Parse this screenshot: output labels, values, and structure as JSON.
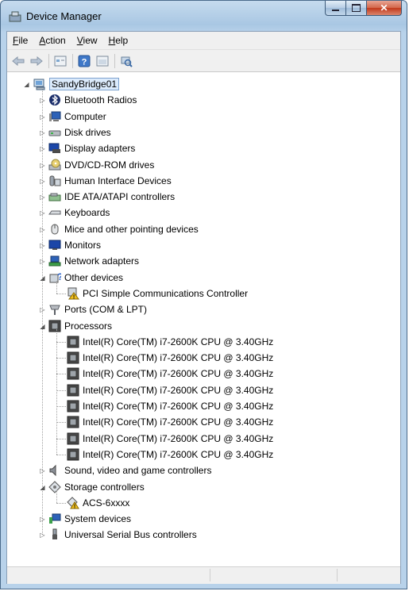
{
  "window": {
    "title": "Device Manager"
  },
  "menu": [
    {
      "label": "File",
      "accel": "F",
      "rest": "ile"
    },
    {
      "label": "Action",
      "accel": "A",
      "rest": "ction"
    },
    {
      "label": "View",
      "accel": "V",
      "rest": "iew"
    },
    {
      "label": "Help",
      "accel": "H",
      "rest": "elp"
    }
  ],
  "toolbar": {
    "icons": [
      "back-arrow-icon",
      "forward-arrow-icon",
      "properties-icon",
      "help-icon",
      "view-icon",
      "scan-hardware-icon"
    ]
  },
  "tree": {
    "root": "SandyBridge01",
    "categories": [
      {
        "label": "Bluetooth Radios",
        "icon": "bluetooth-icon",
        "expanded": false
      },
      {
        "label": "Computer",
        "icon": "computer-icon",
        "expanded": false
      },
      {
        "label": "Disk drives",
        "icon": "disk-icon",
        "expanded": false
      },
      {
        "label": "Display adapters",
        "icon": "display-icon",
        "expanded": false
      },
      {
        "label": "DVD/CD-ROM drives",
        "icon": "dvd-icon",
        "expanded": false
      },
      {
        "label": "Human Interface Devices",
        "icon": "hid-icon",
        "expanded": false
      },
      {
        "label": "IDE ATA/ATAPI controllers",
        "icon": "ide-icon",
        "expanded": false
      },
      {
        "label": "Keyboards",
        "icon": "keyboard-icon",
        "expanded": false
      },
      {
        "label": "Mice and other pointing devices",
        "icon": "mouse-icon",
        "expanded": false
      },
      {
        "label": "Monitors",
        "icon": "monitor-icon",
        "expanded": false
      },
      {
        "label": "Network adapters",
        "icon": "network-icon",
        "expanded": false
      },
      {
        "label": "Other devices",
        "icon": "other-devices-icon",
        "expanded": true,
        "children": [
          {
            "label": "PCI Simple Communications Controller",
            "icon": "warning-device-icon"
          }
        ]
      },
      {
        "label": "Ports (COM & LPT)",
        "icon": "port-icon",
        "expanded": false
      },
      {
        "label": "Processors",
        "icon": "processor-icon",
        "expanded": true,
        "children": [
          {
            "label": "Intel(R) Core(TM) i7-2600K CPU @ 3.40GHz",
            "icon": "processor-icon"
          },
          {
            "label": "Intel(R) Core(TM) i7-2600K CPU @ 3.40GHz",
            "icon": "processor-icon"
          },
          {
            "label": "Intel(R) Core(TM) i7-2600K CPU @ 3.40GHz",
            "icon": "processor-icon"
          },
          {
            "label": "Intel(R) Core(TM) i7-2600K CPU @ 3.40GHz",
            "icon": "processor-icon"
          },
          {
            "label": "Intel(R) Core(TM) i7-2600K CPU @ 3.40GHz",
            "icon": "processor-icon"
          },
          {
            "label": "Intel(R) Core(TM) i7-2600K CPU @ 3.40GHz",
            "icon": "processor-icon"
          },
          {
            "label": "Intel(R) Core(TM) i7-2600K CPU @ 3.40GHz",
            "icon": "processor-icon"
          },
          {
            "label": "Intel(R) Core(TM) i7-2600K CPU @ 3.40GHz",
            "icon": "processor-icon"
          }
        ]
      },
      {
        "label": "Sound, video and game controllers",
        "icon": "speaker-icon",
        "expanded": false
      },
      {
        "label": "Storage controllers",
        "icon": "storage-icon",
        "expanded": true,
        "children": [
          {
            "label": "ACS-6xxxx",
            "icon": "warning-storage-icon"
          }
        ]
      },
      {
        "label": "System devices",
        "icon": "system-icon",
        "expanded": false
      },
      {
        "label": "Universal Serial Bus controllers",
        "icon": "usb-icon",
        "expanded": false
      }
    ]
  }
}
